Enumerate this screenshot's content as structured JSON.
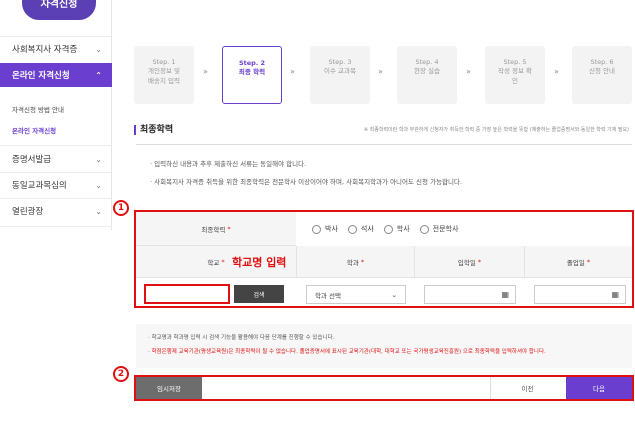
{
  "sidebar": {
    "logo": "자격신청",
    "items": [
      {
        "label": "사회복지사 자격증"
      },
      {
        "label": "온라인 자격신청"
      },
      {
        "label": "증명서발급"
      },
      {
        "label": "동일교과목심의"
      },
      {
        "label": "열린광장"
      }
    ],
    "subitems": [
      {
        "label": "자격신청 방법 안내"
      },
      {
        "label": "온라인 자격신청"
      }
    ]
  },
  "steps": [
    {
      "num": "Step. 1",
      "line1": "개인정보 및",
      "line2": "배송지 입력"
    },
    {
      "num": "Step. 2",
      "line1": "최종 학력",
      "line2": ""
    },
    {
      "num": "Step. 3",
      "line1": "이수 교과목",
      "line2": ""
    },
    {
      "num": "Step. 4",
      "line1": "현장 실습",
      "line2": ""
    },
    {
      "num": "Step. 5",
      "line1": "작성 정보 확",
      "line2": "인"
    },
    {
      "num": "Step. 6",
      "line1": "신청 안내",
      "line2": ""
    }
  ],
  "section": {
    "title": "최종학력",
    "note": "※ 최종학력이란 학과 무관하게 신청자가 취득한 학력 중 가장 높은 학력을 뜻함 (제출하는 졸업증명서와 동일한 학력 기재 필요)"
  },
  "notice": [
    "· 입력하신 내용과 추후 제출하신 서류는 동일해야 합니다.",
    "· 사회복지사 자격증 취득을 위한 최종학력은 전문학사 이상이어야 하며, 사회복지학과가 아니어도 신청 가능합니다."
  ],
  "form": {
    "degree_label": "최종학력",
    "degree_options": [
      "박사",
      "석사",
      "학사",
      "전문학사"
    ],
    "school_label": "학교",
    "school_annotation": "학교명 입력",
    "major_label": "학과",
    "entry_label": "입학일",
    "grad_label": "졸업일",
    "search_button": "검색",
    "major_select": "학과 선택",
    "required_mark": "*"
  },
  "badges": {
    "one": "1",
    "two": "2"
  },
  "notes2": {
    "line1": "· 학교명과 학과명 입력 시 검색 기능을 활용해야 다음 단계를 진행할 수 있습니다.",
    "line2": "· 학점은행제 교육기관(평생교육원)은 최종학력이 될 수 없습니다. 졸업증명서에 표시된 교육기관(대학, 대학교 또는 국가평생교육진흥원) 으로 최종학력을 입력하셔야 합니다."
  },
  "buttons": {
    "temp_save": "임시저장",
    "prev": "이전",
    "next": "다음"
  }
}
